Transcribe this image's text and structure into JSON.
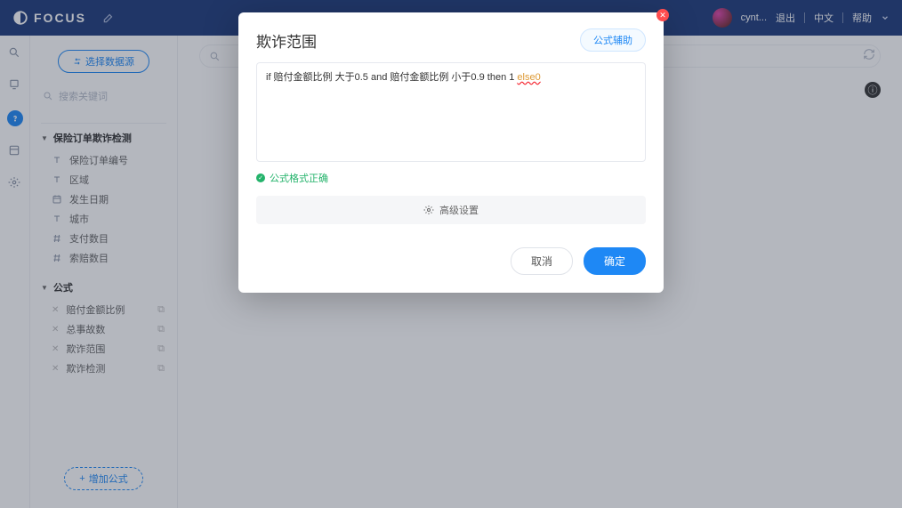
{
  "brand": "FOCUS",
  "user": {
    "name": "cynt..."
  },
  "topnav": {
    "logout": "退出",
    "lang": "中文",
    "help": "帮助"
  },
  "sidebar": {
    "select_source": "选择数据源",
    "search_placeholder": "搜索关键词",
    "group1": {
      "title": "保险订单欺诈检测",
      "fields": [
        "保险订单编号",
        "区域",
        "发生日期",
        "城市",
        "支付数目",
        "索赔数目"
      ]
    },
    "group2": {
      "title": "公式",
      "items": [
        "赔付金额比例",
        "总事故数",
        "欺诈范围",
        "欺诈检测"
      ]
    },
    "add_formula": "增加公式"
  },
  "modal": {
    "title": "欺诈范围",
    "assist": "公式辅助",
    "formula_prefix": "if 赔付金额比例 大于0.5 and 赔付金额比例 小于0.9 then 1 ",
    "formula_err": "else0",
    "status": "公式格式正确",
    "advanced": "高级设置",
    "cancel": "取消",
    "ok": "确定"
  }
}
